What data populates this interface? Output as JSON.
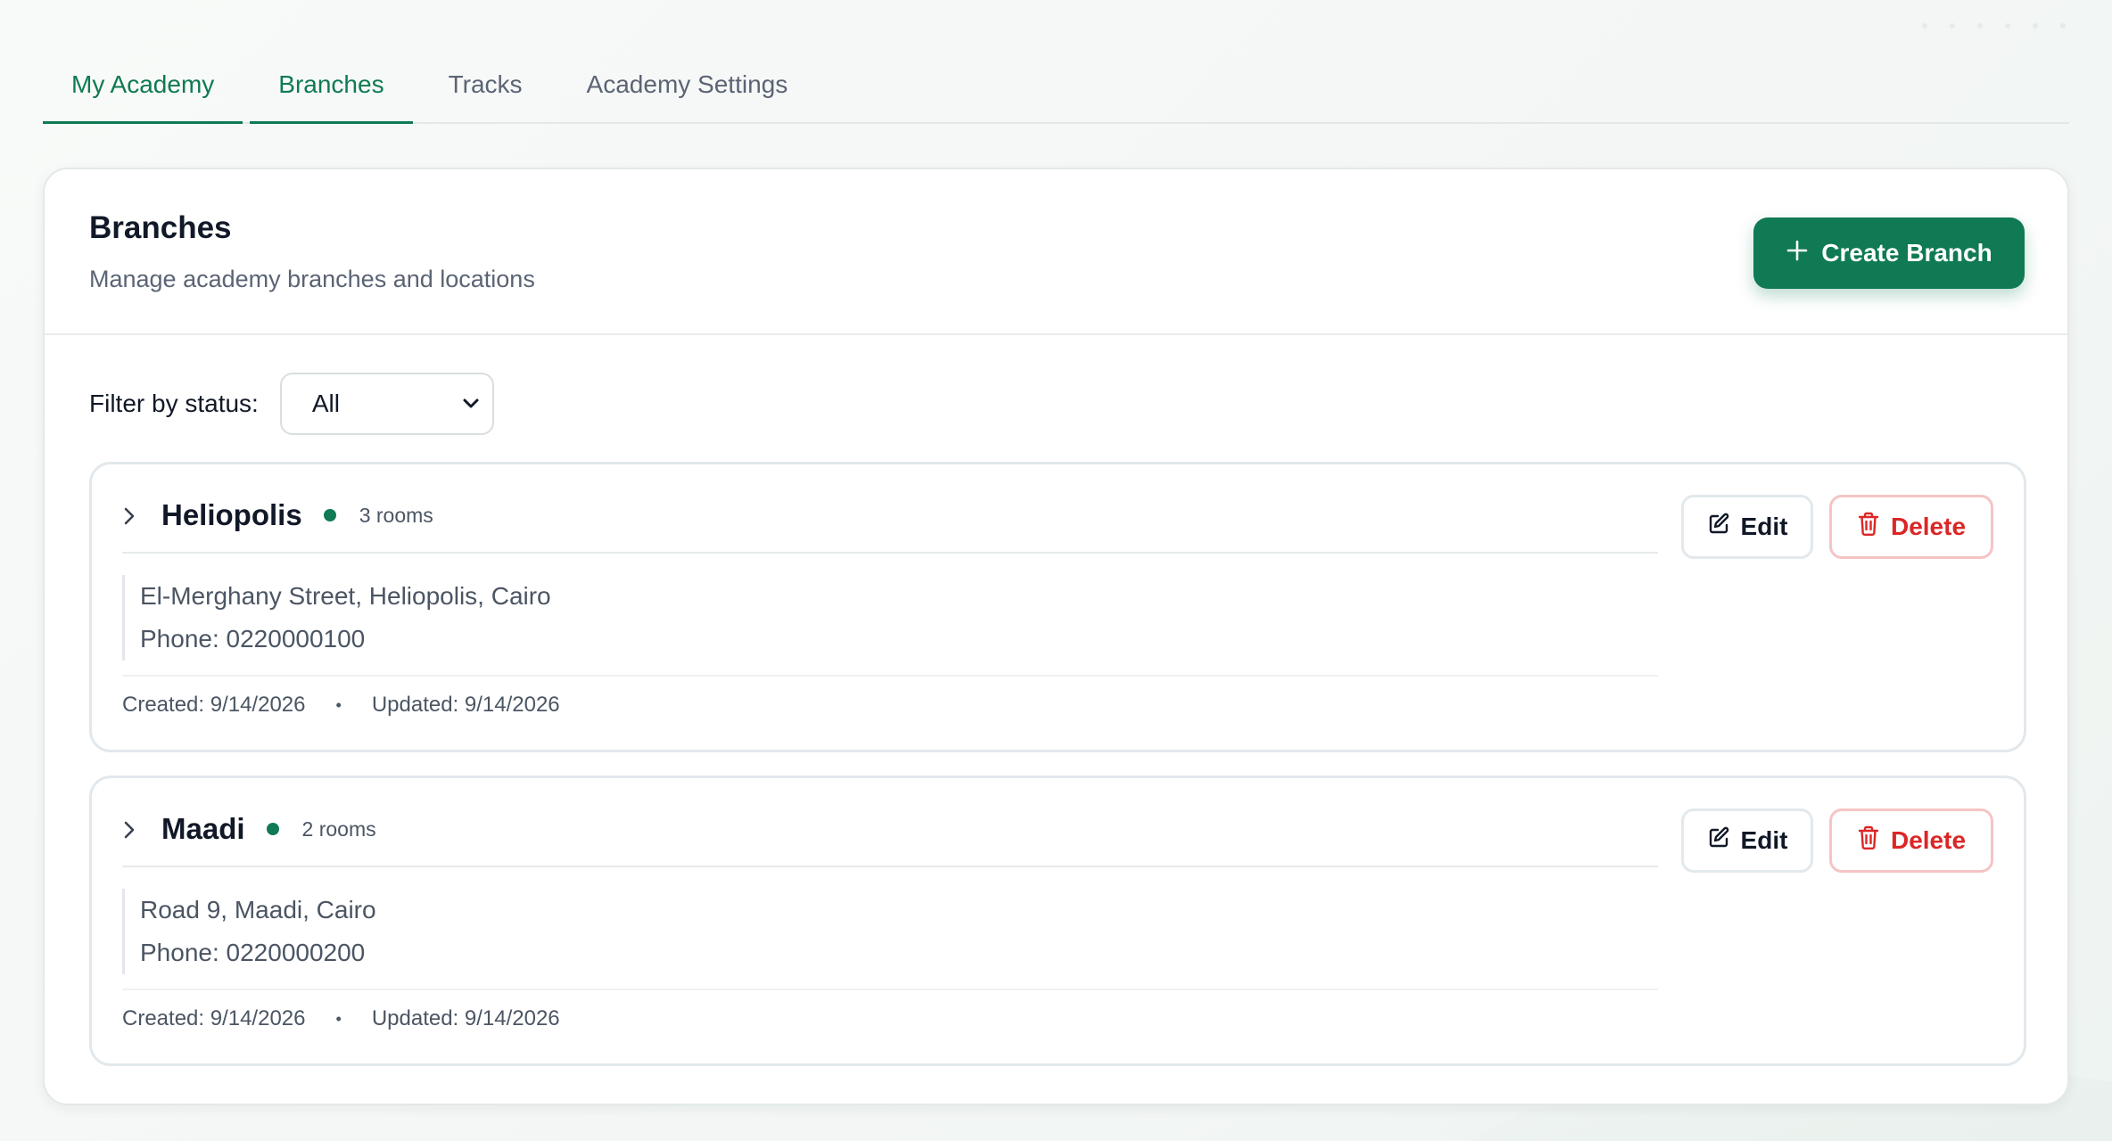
{
  "tabs": [
    {
      "label": "My Academy",
      "active": true
    },
    {
      "label": "Branches",
      "active": true
    },
    {
      "label": "Tracks",
      "active": false
    },
    {
      "label": "Academy Settings",
      "active": false
    }
  ],
  "card": {
    "title": "Branches",
    "subtitle": "Manage academy branches and locations",
    "create_button": {
      "label": "Create Branch",
      "icon": "plus-icon"
    }
  },
  "filter": {
    "label": "Filter by status:",
    "selected": "All"
  },
  "branches": [
    {
      "name": "Heliopolis",
      "status_color": "#0f7a53",
      "rooms": "3 rooms",
      "address": "El-Merghany Street, Heliopolis, Cairo",
      "phone": "Phone: 0220000100",
      "created": "Created: 9/14/2026",
      "separator": "•",
      "updated": "Updated: 9/14/2026",
      "edit_label": "Edit",
      "delete_label": "Delete"
    },
    {
      "name": "Maadi",
      "status_color": "#0f7a53",
      "rooms": "2 rooms",
      "address": "Road 9, Maadi, Cairo",
      "phone": "Phone: 0220000200",
      "created": "Created: 9/14/2026",
      "separator": "•",
      "updated": "Updated: 9/14/2026",
      "edit_label": "Edit",
      "delete_label": "Delete"
    }
  ],
  "colors": {
    "accent": "#0f7a53",
    "danger": "#dc2626"
  }
}
